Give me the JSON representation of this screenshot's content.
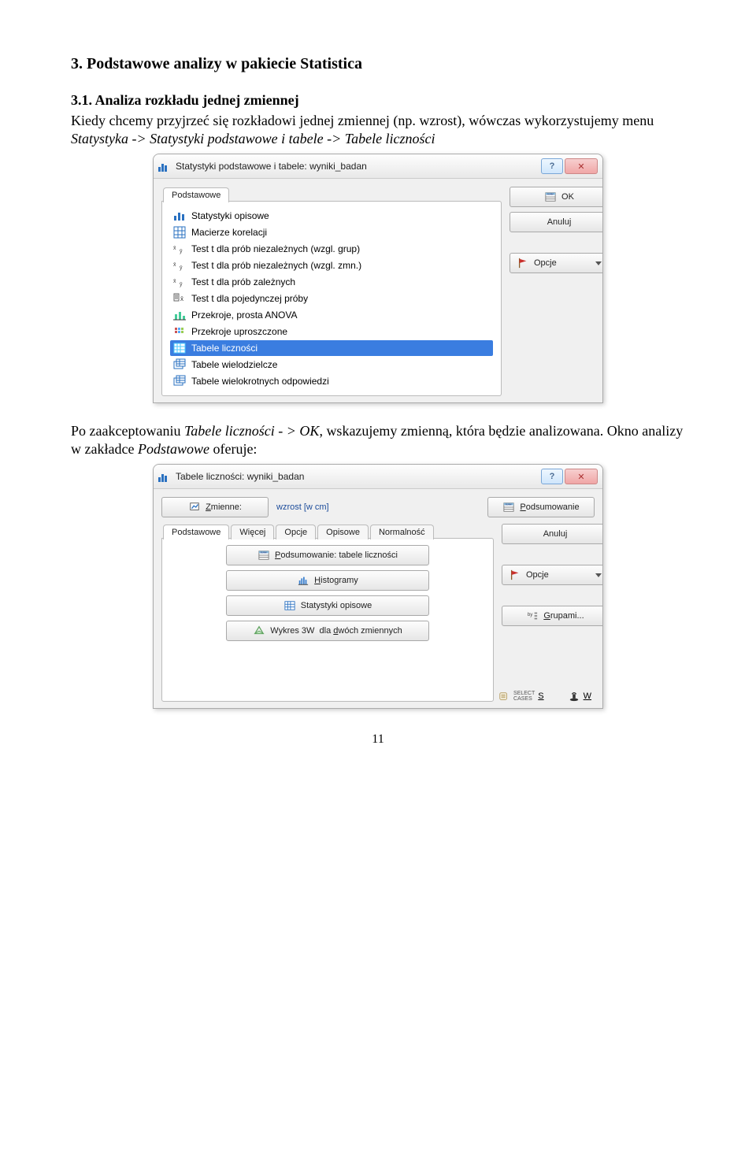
{
  "doc": {
    "heading": "3.  Podstawowe analizy w pakiecie Statistica",
    "subheading": "3.1.      Analiza rozkładu jednej zmiennej",
    "para1a": "Kiedy chcemy przyjrzeć się rozkładowi jednej zmiennej (np. wzrost), wówczas wykorzystujemy menu ",
    "para1b": "Statystyka -> Statystyki podstawowe i tabele -> Tabele liczności",
    "para2a": "Po zaakceptowaniu ",
    "para2b": "Tabele liczności - > OK",
    "para2c": ", wskazujemy zmienną, która będzie analizowana. Okno analizy w zakładce ",
    "para2d": "Podstawowe",
    "para2e": " oferuje:",
    "page_number": "11"
  },
  "dialog1": {
    "title": "Statystyki podstawowe i tabele: wyniki_badan",
    "tab": "Podstawowe",
    "options": {
      "opisowe": "Statystyki opisowe",
      "korelacji": "Macierze korelacji",
      "t_grup": "Test t dla prób niezależnych (wzgl. grup)",
      "t_zmn": "Test t dla prób niezależnych (wzgl. zmn.)",
      "t_zal": "Test t dla prób zależnych",
      "t_poje": "Test t dla pojedynczej próby",
      "anova": "Przekroje, prosta ANOVA",
      "przekroje_upr": "Przekroje uproszczone",
      "tabele_licznosci": "Tabele liczności",
      "tabele_wielo": "Tabele wielodzielcze",
      "tabele_odp": "Tabele wielokrotnych odpowiedzi"
    },
    "buttons": {
      "ok": "OK",
      "anuluj": "Anuluj",
      "opcje": "Opcje"
    }
  },
  "dialog2": {
    "title": "Tabele liczności: wyniki_badan",
    "zmienne_btn": "Zmienne:",
    "zmienne_value": "wzrost [w cm]",
    "tabs": {
      "podstawowe": "Podstawowe",
      "wiecej": "Więcej",
      "opcje": "Opcje",
      "opisowe": "Opisowe",
      "normalnosc": "Normalność"
    },
    "left_buttons": {
      "podsum_tabele": "Podsumowanie: tabele liczności",
      "histo": "Histogramy",
      "staty": "Statystyki opisowe",
      "wykres3w": "Wykres 3W  dla dwóch zmiennych"
    },
    "right_buttons": {
      "podsumowanie": "Podsumowanie",
      "anuluj": "Anuluj",
      "opcje": "Opcje",
      "grupami": "Grupami..."
    },
    "footer": {
      "select_cases_label": "SELECT\nCASES",
      "select_cases_sym": "S",
      "weight_sym": "W"
    }
  }
}
